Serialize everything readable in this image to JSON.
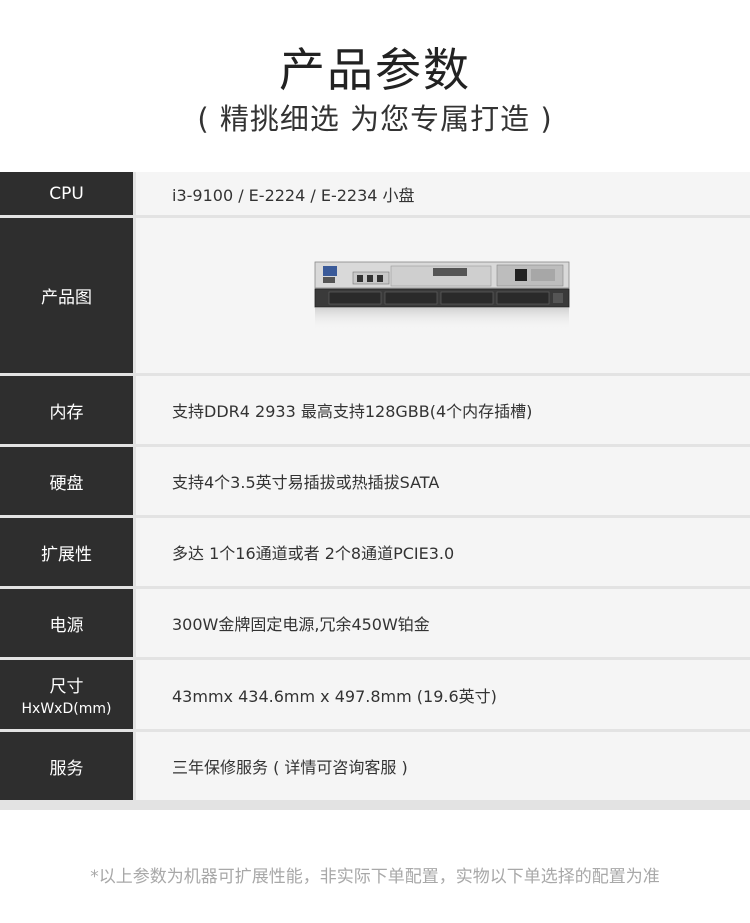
{
  "header": {
    "title": "产品参数",
    "subtitle": "( 精挑细选 为您专属打造 )"
  },
  "specs": [
    {
      "label": "CPU",
      "value": "i3-9100 / E-2224 / E-2234 小盘"
    },
    {
      "label": "产品图",
      "value": ""
    },
    {
      "label": "内存",
      "value": "支持DDR4 2933 最高支持128GBB(4个内存插槽)"
    },
    {
      "label": "硬盘",
      "value": "支持4个3.5英寸易插拔或热插拔SATA"
    },
    {
      "label": "扩展性",
      "value": "多达 1个16通道或者 2个8通道PCIE3.0"
    },
    {
      "label": "电源",
      "value": "300W金牌固定电源,冗余450W铂金"
    },
    {
      "label": "尺寸",
      "label_sub": "HxWxD(mm)",
      "value": "43mmx 434.6mm x 497.8mm (19.6英寸)"
    },
    {
      "label": "服务",
      "value": "三年保修服务 ( 详情可咨询客服 )"
    }
  ],
  "footer": {
    "note": "*以上参数为机器可扩展性能，非实际下单配置，实物以下单选择的配置为准"
  },
  "colors": {
    "label_bg": "#2e2e2e",
    "value_bg": "#f5f5f5",
    "divider": "#e3e3e3",
    "footer_text": "#a8a8a8"
  }
}
